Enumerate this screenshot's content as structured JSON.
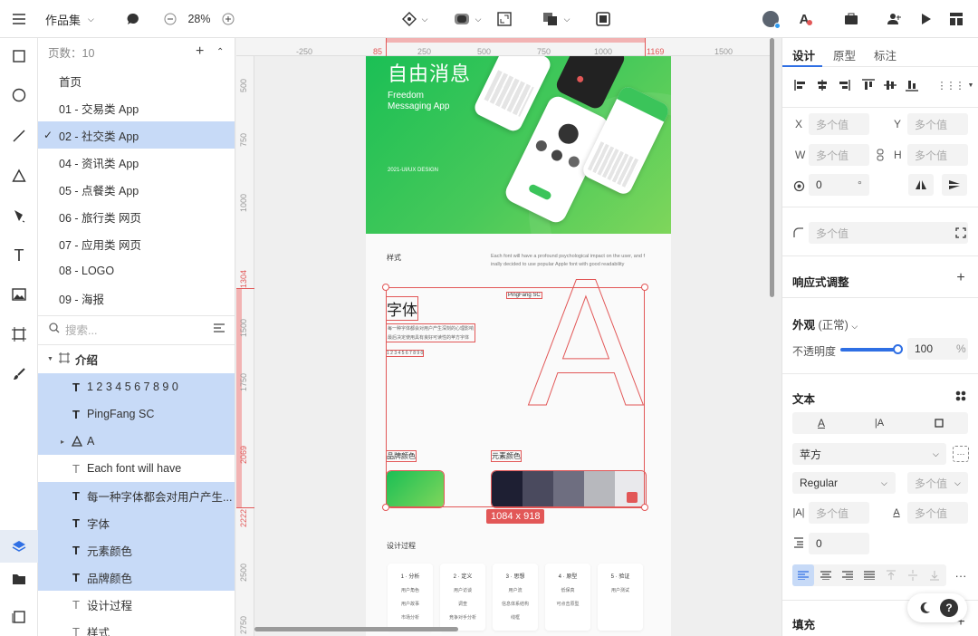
{
  "topbar": {
    "project_name": "作品集",
    "zoom": "28%"
  },
  "layers": {
    "page_count": "页数：10",
    "pages": [
      {
        "label": "首页",
        "selected": false
      },
      {
        "label": "01 - 交易类 App",
        "selected": false
      },
      {
        "label": "02 - 社交类 App",
        "selected": true
      },
      {
        "label": "04 - 资讯类 App",
        "selected": false
      },
      {
        "label": "05 - 点餐类 App",
        "selected": false
      },
      {
        "label": "06 - 旅行类 网页",
        "selected": false
      },
      {
        "label": "07 - 应用类 网页",
        "selected": false
      },
      {
        "label": "08 - LOGO",
        "selected": false
      },
      {
        "label": "09 - 海报",
        "selected": false
      }
    ],
    "search_placeholder": "搜索...",
    "group_name": "介绍",
    "items": [
      {
        "label": "1 2 3 4 5 6 7 8 9 0",
        "selected": true
      },
      {
        "label": "PingFang SC",
        "selected": true
      },
      {
        "label": "A",
        "selected": true
      },
      {
        "label": "Each font will have",
        "selected": false
      },
      {
        "label": "每一种字体都会对用户产生...",
        "selected": true
      },
      {
        "label": "字体",
        "selected": true
      },
      {
        "label": "元素颜色",
        "selected": true
      },
      {
        "label": "品牌颜色",
        "selected": true
      },
      {
        "label": "设计过程",
        "selected": false
      },
      {
        "label": "样式",
        "selected": false
      }
    ]
  },
  "ruler": {
    "top": [
      "85",
      "-250",
      "250",
      "500",
      "750",
      "1000",
      "1169",
      "1500"
    ],
    "left": [
      "500",
      "750",
      "1000",
      "1304",
      "1500",
      "1750",
      "2069",
      "2222",
      "2500",
      "2750"
    ]
  },
  "artboard": {
    "hero_title": "自由消息",
    "hero_sub1": "Freedom",
    "hero_sub2": "Messaging App",
    "hero_year": "2021-UI/UX DESIGN",
    "style_label": "样式",
    "style_desc1": "Each font will have a profound psychological impact on the user, and f",
    "style_desc2": "inally decided to use popular Apple font with good readability",
    "font_title": "字体",
    "font_name": "PingFang SC",
    "font_desc1": "每一种字体都会对用户产生深刻的心理影响",
    "font_desc2": "最后决定使用具有良好可读性的苹方字体",
    "digits": "1 2 3 4 5 6 7 8 9 0",
    "big_letter": "A",
    "brand_color": "品牌颜色",
    "element_color": "元素颜色",
    "size_badge": "1084 x 918",
    "process_title": "设计过程",
    "process": [
      {
        "title": "1 · 分析",
        "lines": [
          "用户角色",
          "用户故事",
          "市场分析"
        ]
      },
      {
        "title": "2 · 定义",
        "lines": [
          "用户访谈",
          "调查",
          "竞争对手分析"
        ]
      },
      {
        "title": "3 · 思想",
        "lines": [
          "用户流",
          "信息体系结构",
          "线框"
        ]
      },
      {
        "title": "4 · 原型",
        "lines": [
          "低保真",
          "可点击原型"
        ]
      },
      {
        "title": "5 · 验证",
        "lines": [
          "用户测试"
        ]
      }
    ]
  },
  "right": {
    "tabs": [
      "设计",
      "原型",
      "标注"
    ],
    "x_label": "X",
    "y_label": "Y",
    "w_label": "W",
    "h_label": "H",
    "multi": "多个值",
    "rotation": "0",
    "degree": "°",
    "responsive": "响应式调整",
    "appearance": "外观",
    "appearance_state": "(正常)",
    "opacity_label": "不透明度",
    "opacity_value": "100",
    "percent": "%",
    "opacity_pct": 100,
    "text_title": "文本",
    "font_family": "苹方",
    "font_weight": "Regular",
    "spacing_value": "0",
    "fill_title": "填充"
  },
  "colors": {
    "accent": "#2f6fe4",
    "brand_green_start": "#1bbf55",
    "brand_green_end": "#7fd65b",
    "swatches": [
      "#1e1f33",
      "#4a4a5e",
      "#6e6e80",
      "#b7b8bd",
      "#e9e9ec"
    ],
    "selection": "#e25757"
  }
}
